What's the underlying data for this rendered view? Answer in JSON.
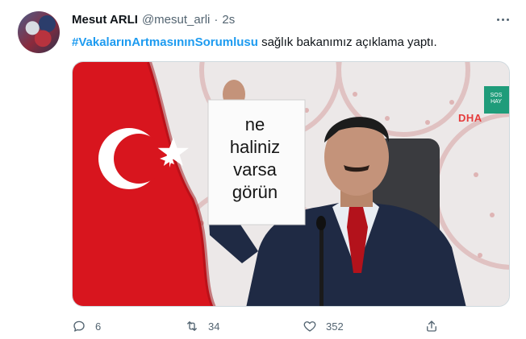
{
  "tweet": {
    "display_name": "Mesut ARLI",
    "handle": "@mesut_arli",
    "separator": "·",
    "time": "2s",
    "hashtag": "#VakalarınArtmasınınSorumlusu",
    "text": " sağlık bakanımız açıklama yaptı.",
    "image": {
      "sign_text": "ne\nhaliniz\nvarsa\ngörün",
      "watermark_logo": "DHA",
      "watermark_sub": "SOS HAY"
    },
    "stats": {
      "replies": "6",
      "retweets": "34",
      "likes": "352"
    },
    "icons": {
      "more": "more-horizontal-icon",
      "reply": "reply-icon",
      "retweet": "retweet-icon",
      "like": "heart-icon",
      "share": "share-icon"
    }
  }
}
